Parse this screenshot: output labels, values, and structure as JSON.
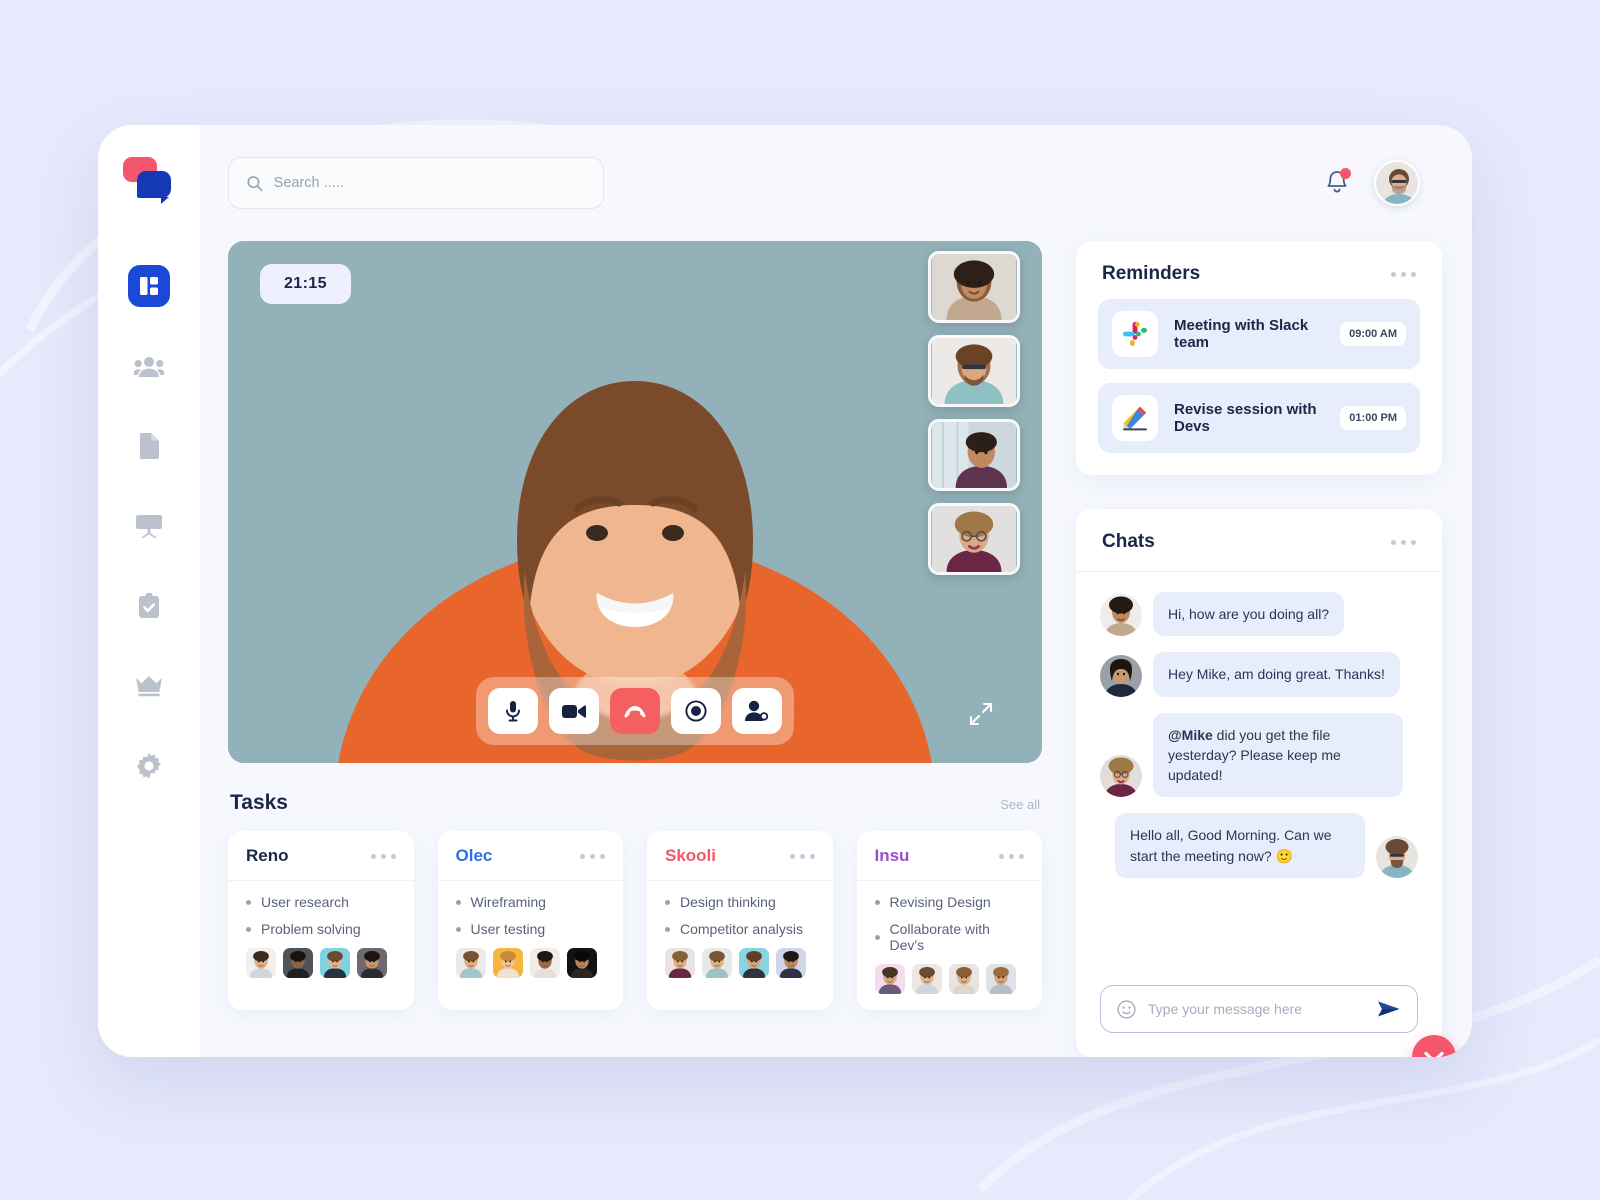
{
  "brand": {
    "logo_name": "chat-bubbles-logo",
    "primary": "#1a49d6",
    "accent": "#f4566b"
  },
  "search": {
    "placeholder": "Search .....",
    "value": ""
  },
  "sidebar": {
    "items": [
      {
        "name": "dashboard",
        "label": "Dashboard",
        "active": true
      },
      {
        "name": "team",
        "label": "Team",
        "active": false
      },
      {
        "name": "documents",
        "label": "Documents",
        "active": false
      },
      {
        "name": "presentations",
        "label": "Presentations",
        "active": false
      },
      {
        "name": "tasks",
        "label": "Tasks",
        "active": false
      },
      {
        "name": "premium",
        "label": "Premium",
        "active": false
      },
      {
        "name": "settings",
        "label": "Settings",
        "active": false
      }
    ]
  },
  "topbar": {
    "notifications_icon": "bell-icon",
    "has_unread": true,
    "avatar": "user-avatar"
  },
  "call": {
    "timer": "21:15",
    "participants": [
      "participant-1",
      "participant-2",
      "participant-3",
      "participant-4"
    ],
    "controls": [
      {
        "name": "microphone",
        "label": "Mute microphone",
        "style": "light"
      },
      {
        "name": "camera",
        "label": "Toggle camera",
        "style": "light"
      },
      {
        "name": "end-call",
        "label": "End call",
        "style": "danger"
      },
      {
        "name": "record",
        "label": "Record",
        "style": "light"
      },
      {
        "name": "add-person",
        "label": "Add participant",
        "style": "light"
      }
    ],
    "expand_label": "Fullscreen"
  },
  "tasks": {
    "title": "Tasks",
    "see_all": "See all",
    "cards": [
      {
        "name": "Reno",
        "color": "#1c2748",
        "items": [
          "User research",
          "Problem solving"
        ],
        "members": 4
      },
      {
        "name": "Olec",
        "color": "#2f6fe4",
        "items": [
          "Wireframing",
          "User testing"
        ],
        "members": 4
      },
      {
        "name": "Skooli",
        "color": "#f4566b",
        "items": [
          "Design thinking",
          "Competitor analysis"
        ],
        "members": 4
      },
      {
        "name": "Insu",
        "color": "#9b4fd0",
        "items": [
          "Revising Design",
          "Collaborate with Dev's"
        ],
        "members": 4
      }
    ]
  },
  "reminders": {
    "title": "Reminders",
    "items": [
      {
        "icon": "slack-icon",
        "label": "Meeting with Slack team",
        "time": "09:00 AM"
      },
      {
        "icon": "pencil-icon",
        "label": "Revise session with Devs",
        "time": "01:00 PM"
      }
    ]
  },
  "chats": {
    "title": "Chats",
    "messages": [
      {
        "from": "in",
        "avatar": "chat-avatar-1",
        "text": "Hi, how are you doing all?"
      },
      {
        "from": "in",
        "avatar": "chat-avatar-2",
        "text": "Hey Mike, am doing great. Thanks!"
      },
      {
        "from": "in",
        "avatar": "chat-avatar-3",
        "mention": "@Mike",
        "text": " did you get the file yesterday? Please keep me updated!"
      },
      {
        "from": "out",
        "avatar": "chat-avatar-4",
        "text": "Hello all, Good Morning. Can we start the meeting now? 🙂"
      }
    ],
    "composer": {
      "placeholder": "Type your message here",
      "value": "",
      "emoji_icon": "smiley-icon",
      "send_icon": "send-icon"
    },
    "scroll_down_label": "Scroll to latest"
  }
}
